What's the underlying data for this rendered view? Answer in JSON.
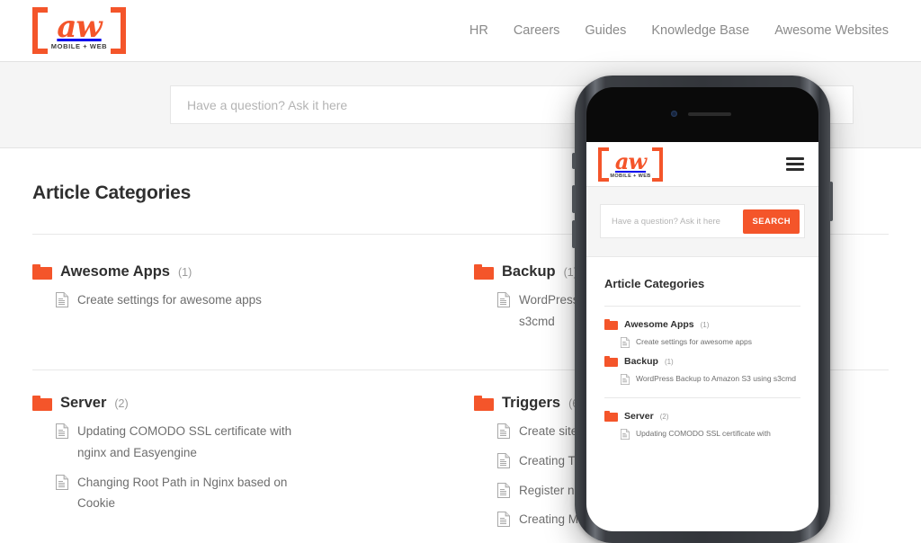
{
  "brand": {
    "accent": "#f4552a",
    "logo_text": "aw",
    "logo_tagline": "MOBILE + WEB",
    "logo_name": "aw-logo"
  },
  "header": {
    "nav": [
      {
        "label": "HR"
      },
      {
        "label": "Careers"
      },
      {
        "label": "Guides"
      },
      {
        "label": "Knowledge Base"
      },
      {
        "label": "Awesome Websites"
      }
    ]
  },
  "search": {
    "placeholder": "Have a question? Ask it here",
    "value": "",
    "button_label": "SEARCH"
  },
  "main": {
    "title": "Article Categories",
    "categories": [
      {
        "name": "Awesome Apps",
        "count": "(1)",
        "articles": [
          "Create settings for awesome apps"
        ]
      },
      {
        "name": "Backup",
        "count": "(1)",
        "articles": [
          "WordPress Backup to Amazon S3 using s3cmd"
        ]
      },
      {
        "name": "Server",
        "count": "(2)",
        "articles": [
          "Updating COMODO SSL certificate with nginx and Easyengine",
          "Changing Root Path in Nginx based on Cookie"
        ]
      },
      {
        "name": "Triggers",
        "count": "(6)",
        "articles": [
          "Create site settings",
          "Creating Theme Options",
          "Register new Taxonomy",
          "Creating Meta Boxes"
        ]
      }
    ]
  },
  "phone": {
    "device": "smartphone-mockup",
    "title": "Article Categories",
    "search_placeholder": "Have a question? Ask it here",
    "search_button_label": "SEARCH",
    "menu_icon": "hamburger-menu-icon",
    "categories": [
      {
        "name": "Awesome Apps",
        "count": "(1)",
        "articles": [
          "Create settings for awesome apps"
        ]
      },
      {
        "name": "Backup",
        "count": "(1)",
        "articles": [
          "WordPress Backup to Amazon S3 using s3cmd"
        ]
      },
      {
        "name": "Server",
        "count": "(2)",
        "articles": [
          "Updating COMODO SSL certificate with"
        ]
      }
    ]
  }
}
